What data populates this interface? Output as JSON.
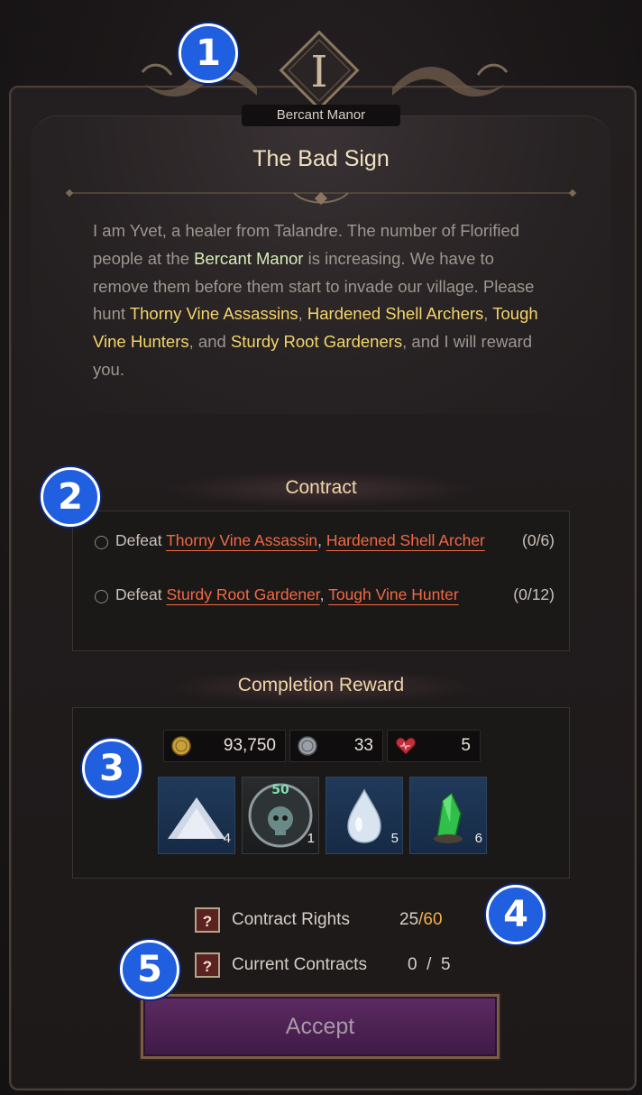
{
  "region": {
    "emblem_numeral": "I",
    "name": "Bercant Manor"
  },
  "quest": {
    "title": "The Bad Sign",
    "description": {
      "p1": "I am Yvet, a healer from Talandre. The number of Florified people at the ",
      "location": "Bercant Manor",
      "p2": " is increasing. We have to remove them before them start to invade our village. Please hunt ",
      "target1": "Thorny Vine Assassins",
      "sep1": ", ",
      "target2": "Hardened Shell Archers",
      "sep2": ", ",
      "target3": "Tough Vine Hunters",
      "sep3": ", and ",
      "target4": "Sturdy Root Gardeners",
      "p3": ", and I will reward you."
    }
  },
  "contract": {
    "heading": "Contract",
    "objectives": [
      {
        "verb": "Defeat",
        "target_a": "Thorny Vine Assassin",
        "sep": ", ",
        "target_b": "Hardened Shell Archer",
        "progress": "(0/6)"
      },
      {
        "verb": "Defeat",
        "target_a": "Sturdy Root Gardener",
        "sep": ", ",
        "target_b": "Tough Vine Hunter",
        "progress": "(0/12)"
      }
    ]
  },
  "reward": {
    "heading": "Completion Reward",
    "currencies": [
      {
        "icon": "gold-coin-icon",
        "value": "93,750"
      },
      {
        "icon": "silver-coin-icon",
        "value": "33"
      },
      {
        "icon": "heart-icon",
        "value": "5"
      }
    ],
    "items": [
      {
        "icon": "crystal-powder-icon",
        "count": "4"
      },
      {
        "icon": "skull-orb-icon",
        "count": "1",
        "level": "50"
      },
      {
        "icon": "water-drop-icon",
        "count": "5"
      },
      {
        "icon": "green-crystal-icon",
        "count": "6"
      }
    ]
  },
  "stats": {
    "contract_rights_label": "Contract Rights",
    "contract_rights_current": "25",
    "contract_rights_sep": "/",
    "contract_rights_max": "60",
    "current_contracts_label": "Current Contracts",
    "current_contracts_value": "0  /  5"
  },
  "accept_label": "Accept",
  "badges": [
    "1",
    "2",
    "3",
    "4",
    "5"
  ],
  "colors": {
    "highlight_location": "#d7eeb8",
    "highlight_target": "#f4d56a",
    "objective_link": "#f06a45",
    "badge_blue": "#1f5fe0",
    "accept_purple": "#5c2a62"
  }
}
